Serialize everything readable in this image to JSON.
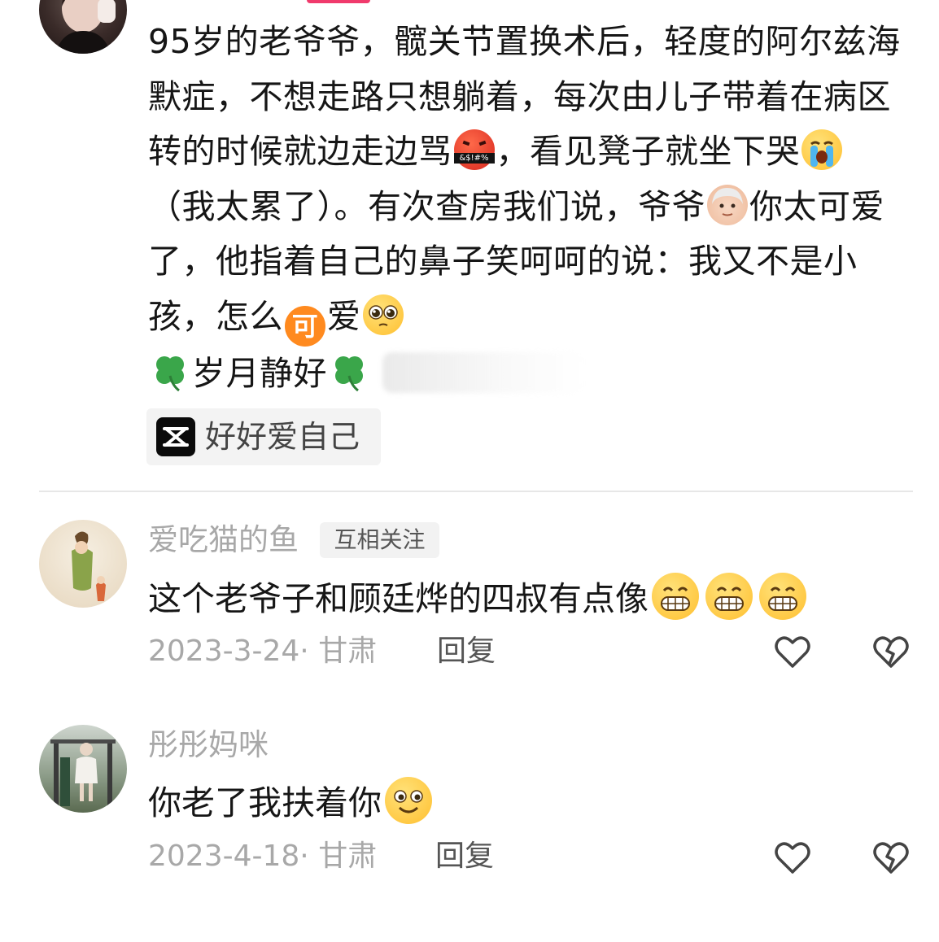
{
  "post": {
    "text_segments": [
      "95岁的老爷爷，髋关节置换术后，轻度的阿尔兹海默症，不想走路只想躺着，每次由儿子带着在病区转的时候就边走边骂",
      "，看见凳子就坐下哭",
      "（我太累了）。有次查房我们说，爷爷",
      "你太可爱了，他指着自己的鼻子笑呵呵的说：我又不是小孩，怎么",
      "爱",
      "岁月静好"
    ],
    "emoji": {
      "cursing": "&$!#%",
      "ke_badge": "可"
    },
    "music_tag": "好好爱自己"
  },
  "comments": [
    {
      "username": "爱吃猫的鱼",
      "badge": "互相关注",
      "text": "这个老爷子和顾廷烨的四叔有点像",
      "date_location": "2023-3-24· 甘肃",
      "reply_label": "回复"
    },
    {
      "username": "彤彤妈咪",
      "text": "你老了我扶着你",
      "date_location": "2023-4-18· 甘肃",
      "reply_label": "回复"
    }
  ],
  "icons": [
    "avatar",
    "cursing-face-emoji",
    "crying-face-emoji",
    "old-man-emoji",
    "ke-badge-emoji",
    "pleading-face-emoji",
    "four-leaf-clover-emoji",
    "capcut-logo-icon",
    "grinning-face-emoji",
    "smiling-face-emoji",
    "heart-outline-icon",
    "broken-heart-outline-icon"
  ],
  "colors": {
    "accent_pink": "#f03a6c",
    "muted_text": "#a8a8a8",
    "emoji_yellow": "#ffc83d",
    "badge_orange": "#ff8a1f",
    "clover_green": "#3aa64a"
  }
}
